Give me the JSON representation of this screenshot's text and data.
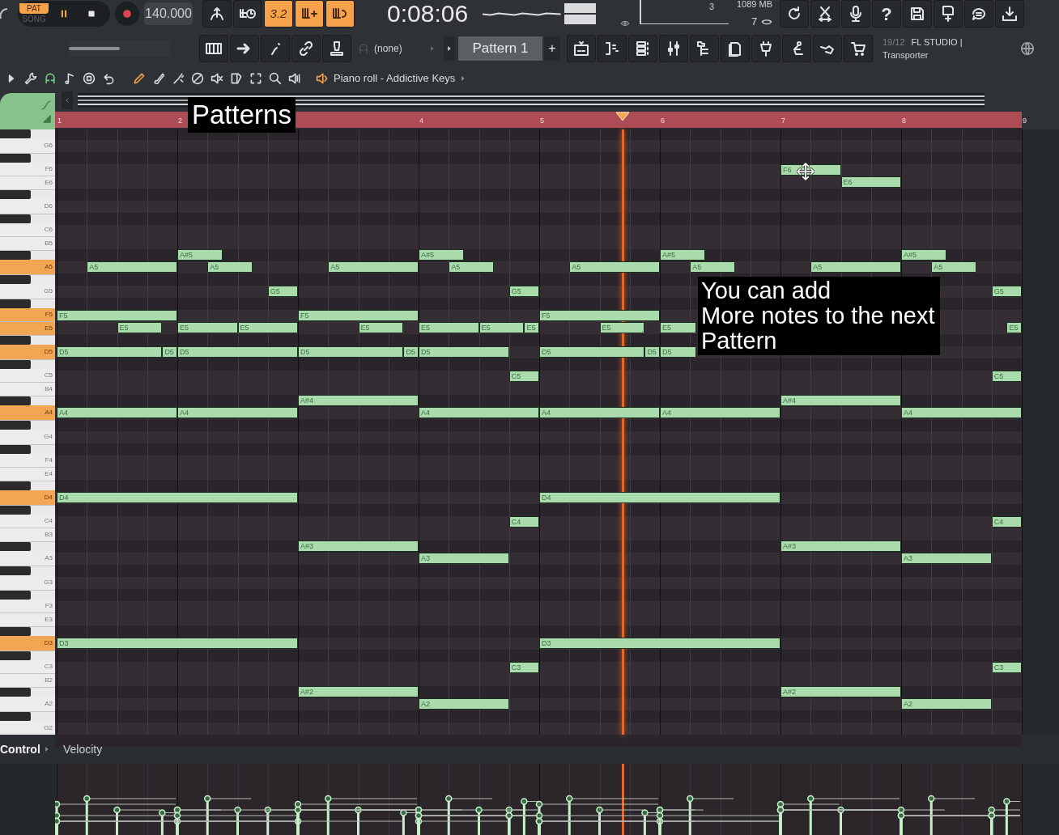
{
  "transport": {
    "mode": [
      {
        "label": "PAT",
        "selected": true
      },
      {
        "label": "SONG",
        "selected": false
      }
    ],
    "tempo": "140.000",
    "time": "0:08:06"
  },
  "top_buttons": [
    {
      "on": false
    },
    {
      "on": false
    },
    {
      "on": true,
      "label": "3.2"
    },
    {
      "on": true
    },
    {
      "on": true
    }
  ],
  "monitor": {
    "cpu": "3",
    "memory": "1089 MB",
    "voices": "7"
  },
  "system_buttons": {
    "help": "?"
  },
  "pattern_bar": {
    "preset": "(none)",
    "pattern": "Pattern 1",
    "add": "+"
  },
  "hint": {
    "date": "19/12",
    "title": "FL STUDIO |",
    "text": "Transporter"
  },
  "master_pitch": {
    "level": 0.5
  },
  "piano_roll": {
    "title": "Piano roll - Addictive Keys",
    "tools": [
      {
        "selected": false
      },
      {
        "selected": false
      },
      {
        "selected": true
      },
      {
        "selected": false
      },
      {
        "selected": false
      },
      {
        "selected": false
      },
      {
        "selected": true
      },
      {
        "selected": false
      },
      {
        "selected": false
      },
      {
        "selected": false
      },
      {
        "selected": false
      },
      {
        "selected": false
      },
      {
        "selected": false
      },
      {
        "selected": false
      },
      {
        "selected": false
      }
    ]
  },
  "ruler": [
    "1",
    "2",
    "4",
    "5",
    "6",
    "7",
    "8",
    "9"
  ],
  "keys": [
    {
      "label": "G6",
      "highlighted": false
    },
    {
      "label": "F6",
      "highlighted": false
    },
    {
      "label": "E6",
      "highlighted": false
    },
    {
      "label": "D6",
      "highlighted": false
    },
    {
      "label": "C6",
      "highlighted": false
    },
    {
      "label": "B5",
      "highlighted": false
    },
    {
      "label": "A5",
      "highlighted": true
    },
    {
      "label": "G5",
      "highlighted": false
    },
    {
      "label": "F5",
      "highlighted": true
    },
    {
      "label": "E5",
      "highlighted": true
    },
    {
      "label": "D5",
      "highlighted": true
    },
    {
      "label": "C5",
      "highlighted": false
    },
    {
      "label": "B4",
      "highlighted": false
    },
    {
      "label": "A4",
      "highlighted": true
    },
    {
      "label": "G4",
      "highlighted": false
    },
    {
      "label": "F4",
      "highlighted": false
    },
    {
      "label": "E4",
      "highlighted": false
    },
    {
      "label": "D4",
      "highlighted": true
    },
    {
      "label": "C4",
      "highlighted": false
    },
    {
      "label": "B3",
      "highlighted": false
    },
    {
      "label": "A3",
      "highlighted": false
    },
    {
      "label": "G3",
      "highlighted": false
    },
    {
      "label": "F3",
      "highlighted": false
    },
    {
      "label": "E3",
      "highlighted": false
    },
    {
      "label": "D3",
      "highlighted": true
    },
    {
      "label": "C3",
      "highlighted": false
    },
    {
      "label": "B2",
      "highlighted": false
    },
    {
      "label": "A2",
      "highlighted": false
    },
    {
      "label": "G2",
      "highlighted": false
    }
  ],
  "notes": [
    {
      "label": "F6"
    },
    {
      "label": "E6"
    },
    {
      "label": "A#5"
    },
    {
      "label": "A#5"
    },
    {
      "label": "A#5"
    },
    {
      "label": "A#5"
    },
    {
      "label": "A5"
    },
    {
      "label": "A5"
    },
    {
      "label": "A5"
    },
    {
      "label": "A5"
    },
    {
      "label": "A5"
    },
    {
      "label": "A5"
    },
    {
      "label": "A5"
    },
    {
      "label": "A5"
    },
    {
      "label": "G5"
    },
    {
      "label": "G5"
    },
    {
      "label": "G5"
    },
    {
      "label": "F5"
    },
    {
      "label": "F5"
    },
    {
      "label": "F5"
    },
    {
      "label": "E5"
    },
    {
      "label": "E5"
    },
    {
      "label": "E5"
    },
    {
      "label": "E5"
    },
    {
      "label": "E5"
    },
    {
      "label": "E5"
    },
    {
      "label": "E5"
    },
    {
      "label": "E5"
    },
    {
      "label": "E5"
    },
    {
      "label": "E5"
    },
    {
      "label": "D5"
    },
    {
      "label": "D5"
    },
    {
      "label": "D5"
    },
    {
      "label": "D5"
    },
    {
      "label": "D5"
    },
    {
      "label": "D5"
    },
    {
      "label": "D5"
    },
    {
      "label": "D5"
    },
    {
      "label": "D5"
    },
    {
      "label": "C5"
    },
    {
      "label": "C5"
    },
    {
      "label": "A#4"
    },
    {
      "label": "A#4"
    },
    {
      "label": "A4"
    },
    {
      "label": "A4"
    },
    {
      "label": "A4"
    },
    {
      "label": "A4"
    },
    {
      "label": "A4"
    },
    {
      "label": "A4"
    },
    {
      "label": "D4"
    },
    {
      "label": "D4"
    },
    {
      "label": "C4"
    },
    {
      "label": "C4"
    },
    {
      "label": "A#3"
    },
    {
      "label": "A#3"
    },
    {
      "label": "A3"
    },
    {
      "label": "A3"
    },
    {
      "label": "D3"
    },
    {
      "label": "D3"
    },
    {
      "label": "C3"
    },
    {
      "label": "C3"
    },
    {
      "label": "A#2"
    },
    {
      "label": "A#2"
    },
    {
      "label": "A2"
    },
    {
      "label": "A2"
    }
  ],
  "playhead": {
    "level": 0.587
  },
  "control": {
    "label": "Control",
    "parameter": "Velocity"
  },
  "captions": [
    {
      "lines": [
        "Patterns"
      ]
    },
    {
      "lines": [
        "You can add",
        "More notes to the next",
        "Pattern"
      ]
    }
  ]
}
